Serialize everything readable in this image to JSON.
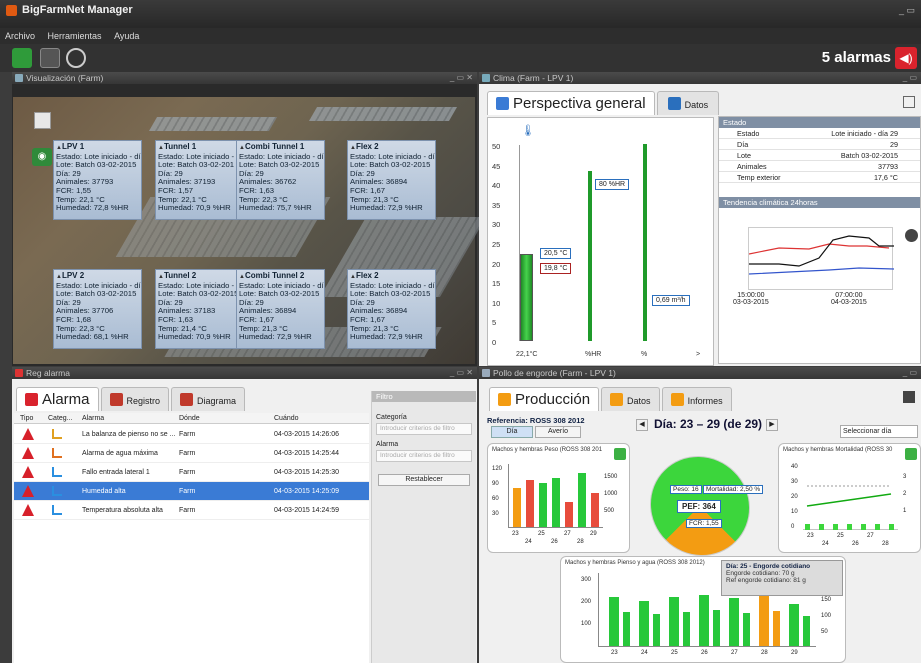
{
  "app": {
    "title": "BigFarmNet Manager",
    "menu": [
      "Archivo",
      "Herramientas",
      "Ayuda"
    ],
    "alarm_count": "5 alarmas"
  },
  "farm_panel": {
    "title": "Visualización (Farm)",
    "houses": [
      {
        "name": "LPV 1",
        "lines": [
          "Estado: Lote iniciado - día",
          "Lote: Batch 03-02-2015",
          "Día: 29",
          "Animales: 37793",
          "FCR: 1,55",
          "Temp: 22,1 °C",
          "Humedad: 72,8 %HR"
        ]
      },
      {
        "name": "Tunnel 1",
        "lines": [
          "Estado: Lote iniciado - día 29",
          "Lote: Batch 03-02-201",
          "Día: 29",
          "Animales: 37193",
          "FCR: 1,57",
          "Temp: 22,1 °C",
          "Humedad: 70,9 %HR"
        ]
      },
      {
        "name": "Combi Tunnel 1",
        "lines": [
          "Estado: Lote iniciado - día 29",
          "Lote: Batch 03-02-2015",
          "Día: 29",
          "Animales: 36762",
          "FCR: 1,63",
          "Temp: 22,3 °C",
          "Humedad: 75,7 %HR"
        ]
      },
      {
        "name": "Flex 2",
        "lines": [
          "Estado: Lote iniciado - día 29",
          "Lote: Batch 03-02-2015",
          "Día: 29",
          "Animales: 36894",
          "FCR: 1,67",
          "Temp: 21,3 °C",
          "Humedad: 72,9 %HR"
        ]
      },
      {
        "name": "LPV 2",
        "lines": [
          "Estado: Lote iniciado - día",
          "Lote: Batch 03-02-2015",
          "Día: 29",
          "Animales: 37706",
          "FCR: 1,68",
          "Temp: 22,3 °C",
          "Humedad: 68,1 %HR"
        ]
      },
      {
        "name": "Tunnel 2",
        "lines": [
          "Estado: Lote iniciado - día 29",
          "Lote: Batch 03-02-2015",
          "Día: 29",
          "Animales: 37183",
          "FCR: 1,63",
          "Temp: 21,4 °C",
          "Humedad: 70,9 %HR"
        ]
      },
      {
        "name": "Combi Tunnel 2",
        "lines": [
          "Estado: Lote iniciado - día 29",
          "Lote: Batch 03-02-2015",
          "Día: 29",
          "Animales: 36894",
          "FCR: 1,67",
          "Temp: 21,3 °C",
          "Humedad: 72,9 %HR"
        ]
      },
      {
        "name": "Flex 2",
        "lines": [
          "Estado: Lote iniciado - día 29",
          "Lote: Batch 03-02-2015",
          "Día: 29",
          "Animales: 36894",
          "FCR: 1,67",
          "Temp: 21,3 °C",
          "Humedad: 72,9 %HR"
        ]
      }
    ]
  },
  "clima": {
    "title": "Clima (Farm - LPV 1)",
    "tabs": [
      "Perspectiva general",
      "Datos"
    ],
    "gauge": {
      "ticks": [
        "50",
        "45",
        "40",
        "35",
        "30",
        "25",
        "20",
        "15",
        "10",
        "5",
        "0"
      ],
      "bottom": [
        "22,1°C",
        "%HR",
        "%",
        ">"
      ],
      "flags": [
        "80 %HR",
        "20,5 °C",
        "19,8 °C",
        "0,69 m³/h"
      ],
      "temp_level": 22.1
    },
    "estado": {
      "header": "Estado",
      "rows": [
        {
          "k": "Estado",
          "v": "Lote iniciado - día 29"
        },
        {
          "k": "Día",
          "v": "29"
        },
        {
          "k": "Lote",
          "v": "Batch 03-02-2015"
        },
        {
          "k": "Animales",
          "v": "37793"
        },
        {
          "k": "Temp exterior",
          "v": "17,6 °C"
        }
      ],
      "trend_header": "Tendencia climática 24horas",
      "trend_x": [
        "15:00:00\n03-03-2015",
        "07:00:00\n04-03-2015"
      ]
    }
  },
  "alarm_panel": {
    "title": "Reg alarma",
    "tabs": [
      "Alarma",
      "Registro",
      "Diagrama"
    ],
    "columns": [
      "Tipo",
      "Categ...",
      "Alarma",
      "Dónde",
      "Cuándo"
    ],
    "rows": [
      {
        "alarm": "La balanza de pienso no se ...",
        "where": "Farm",
        "when": "04-03-2015 14:26:06"
      },
      {
        "alarm": "Alarma de agua máxima",
        "where": "Farm",
        "when": "04-03-2015 14:25:44"
      },
      {
        "alarm": "Fallo entrada lateral 1",
        "where": "Farm",
        "when": "04-03-2015 14:25:30"
      },
      {
        "alarm": "Humedad alta",
        "where": "Farm",
        "when": "04-03-2015 14:25:09"
      },
      {
        "alarm": "Temperatura absoluta alta",
        "where": "Farm",
        "when": "04-03-2015 14:24:59"
      }
    ],
    "filter": {
      "title": "Filtro",
      "category": "Categoría",
      "alarm": "Alarma",
      "placeholder": "Introducir criterios de filtro",
      "reset": "Restablecer"
    }
  },
  "prod": {
    "title": "Pollo de engorde (Farm - LPV 1)",
    "tabs": [
      "Producción",
      "Datos",
      "Informes"
    ],
    "reference": "Referencia: ROSS 308 2012",
    "day_btn": "Día",
    "avg_btn": "Averío",
    "range": "Día: 23 – 29 (de 29)",
    "select_day": "Seleccionar día",
    "pie": {
      "peso": "Peso: 16",
      "mort": "Mortalidad: 2,50 %",
      "pef": "PEF: 364",
      "fcr": "FCR: 1,55"
    },
    "chart_left": {
      "caption": "Machos y hembras  Peso (ROSS 308 201",
      "yticks": [
        "120",
        "90",
        "60",
        "30"
      ],
      "y2": [
        "1500",
        "1000",
        "500"
      ],
      "x": [
        "23",
        "24",
        "25",
        "26",
        "27",
        "28",
        "29"
      ],
      "ylabel": "Engorde cotidiano [g]",
      "y2label": "Peso de los avis (g)"
    },
    "chart_right": {
      "caption": "Machos y hembras  Mortalidad (ROSS 30",
      "yticks": [
        "40",
        "30",
        "20",
        "10",
        "0"
      ],
      "y2": [
        "3",
        "2",
        "1"
      ],
      "x": [
        "23",
        "24",
        "25",
        "26",
        "27",
        "28"
      ],
      "ylabel": "Muertas y descartadas - por día",
      "y2label": "Mortalidad [%]"
    },
    "chart_bottom": {
      "caption": "Machos y hembras Pienso y agua (ROSS 308 2012)",
      "yticks": [
        "300",
        "200",
        "100"
      ],
      "y2": [
        "200",
        "150",
        "100",
        "50"
      ],
      "x": [
        "23",
        "24",
        "25",
        "26",
        "27",
        "28",
        "29"
      ],
      "ylabel": "Pienso/ave - al día (g)",
      "mid_label": "Agua/ave - por día (ml)",
      "y2label": "Agua/Pienso - por día"
    },
    "tooltip": {
      "title": "Día: 25 - Engorde cotidiano",
      "l1": "Engorde cotidiano: 70 g",
      "l2": "Ref engorde cotidiano: 81 g"
    }
  },
  "chart_data": [
    {
      "type": "bar",
      "title": "Machos y hembras  Peso (ROSS 308 201",
      "ylabel": "Engorde cotidiano [g]",
      "categories": [
        "23",
        "24",
        "25",
        "26",
        "27",
        "28",
        "29"
      ],
      "values": [
        80,
        95,
        90,
        100,
        50,
        110,
        70
      ],
      "colors": [
        "#f39c12",
        "#e74c3c",
        "#27c83a",
        "#27c83a",
        "#e74c3c",
        "#27c83a",
        "#e74c3c"
      ],
      "ylim": [
        0,
        130
      ]
    },
    {
      "type": "bar",
      "title": "Machos y hembras Pienso y agua (ROSS 308 2012)",
      "ylabel": "Pienso/ave - al día (g)",
      "categories": [
        "23",
        "24",
        "25",
        "26",
        "27",
        "28",
        "29"
      ],
      "values": [
        230,
        215,
        230,
        240,
        225,
        235,
        200
      ],
      "colors": [
        "#27c83a",
        "#27c83a",
        "#27c83a",
        "#27c83a",
        "#27c83a",
        "#f39c12",
        "#27c83a"
      ],
      "ylim": [
        0,
        350
      ]
    }
  ]
}
